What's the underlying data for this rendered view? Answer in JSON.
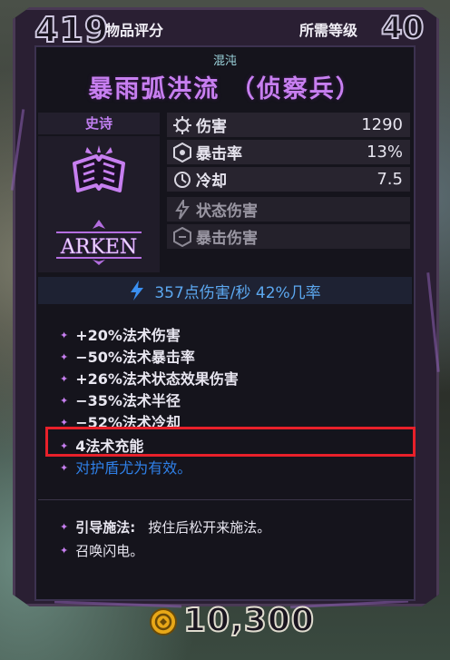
{
  "header": {
    "item_score": "419",
    "item_score_label": "物品评分",
    "required_level_label": "所需等级",
    "required_level": "40"
  },
  "item": {
    "element": "混沌",
    "name": "暴雨弧洪流 （侦察兵）",
    "rarity": "史诗",
    "manufacturer": "ARKEN",
    "type_icon": "spellbook-icon"
  },
  "stats": [
    {
      "icon": "damage-icon",
      "label": "伤害",
      "value": "1290"
    },
    {
      "icon": "crit-icon",
      "label": "暴击率",
      "value": "13%"
    },
    {
      "icon": "cooldown-icon",
      "label": "冷却",
      "value": "7.5"
    },
    {
      "icon": "status-damage-icon",
      "label": "状态伤害",
      "value": ""
    },
    {
      "icon": "crit-damage-icon",
      "label": "暴击伤害",
      "value": ""
    }
  ],
  "dps": {
    "icon": "lightning-icon",
    "text": "357点伤害/秒  42%几率"
  },
  "perks": [
    "+20%法术伤害",
    "−50%法术暴击率",
    "+26%法术状态效果伤害",
    "−35%法术半径",
    "−52%法术冷却",
    "4法术充能",
    "对护盾尤为有效。"
  ],
  "abilities": [
    {
      "title": "引导施法:",
      "text": "按住后松开来施法。"
    },
    {
      "title": "",
      "text": "召唤闪电。"
    }
  ],
  "price": {
    "icon": "gold-coin-icon",
    "value": "10,300"
  },
  "colors": {
    "rarity_purple": "#c77ff0",
    "elemental_blue": "#5ca8f0",
    "highlight_red": "#e8202a"
  }
}
